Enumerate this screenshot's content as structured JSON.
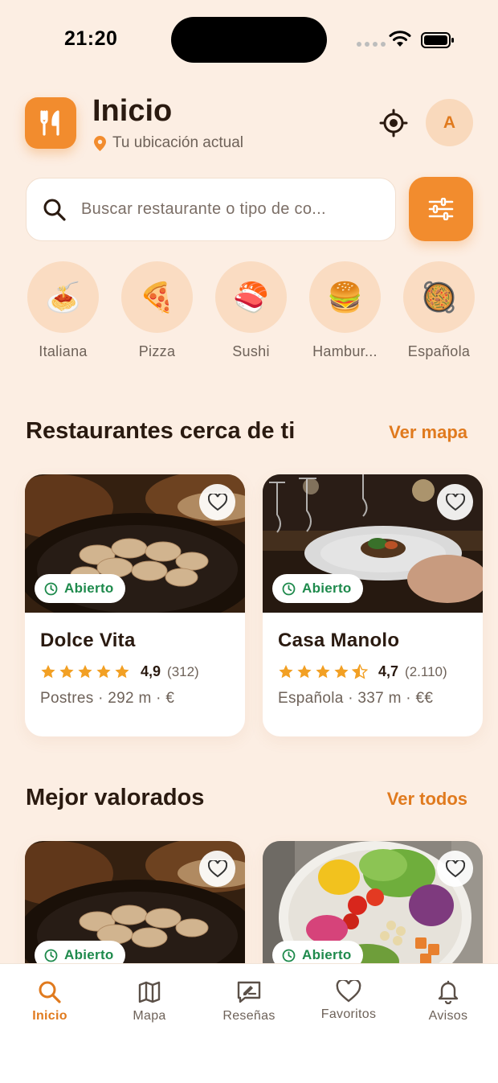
{
  "status": {
    "time": "21:20"
  },
  "header": {
    "title": "Inicio",
    "location": "Tu ubicación actual",
    "avatar_initial": "A"
  },
  "search": {
    "placeholder": "Buscar restaurante o tipo de co..."
  },
  "categories": [
    {
      "label": "Italiana",
      "emoji": "🍝"
    },
    {
      "label": "Pizza",
      "emoji": "🍕"
    },
    {
      "label": "Sushi",
      "emoji": "🍣"
    },
    {
      "label": "Hambur...",
      "emoji": "🍔"
    },
    {
      "label": "Española",
      "emoji": "🥘"
    }
  ],
  "nearby": {
    "title": "Restaurantes cerca de ti",
    "link": "Ver mapa",
    "cards": [
      {
        "name": "Dolce Vita",
        "status": "Abierto",
        "rating": "4,9",
        "rating_stars": 5,
        "reviews": "(312)",
        "meta": "Postres · 292 m · €",
        "photo": "dumplings"
      },
      {
        "name": "Casa Manolo",
        "status": "Abierto",
        "rating": "4,7",
        "rating_stars": 4.5,
        "reviews": "(2.110)",
        "meta": "Española · 337 m · €€",
        "photo": "fine-dining"
      }
    ]
  },
  "top_rated": {
    "title": "Mejor valorados",
    "link": "Ver todos",
    "cards": [
      {
        "status": "Abierto",
        "photo": "dumplings"
      },
      {
        "status": "Abierto",
        "photo": "salad-bowl"
      }
    ]
  },
  "tabs": [
    {
      "label": "Inicio",
      "icon": "search-icon",
      "active": true
    },
    {
      "label": "Mapa",
      "icon": "map-icon",
      "active": false
    },
    {
      "label": "Reseñas",
      "icon": "review-icon",
      "active": false
    },
    {
      "label": "Favoritos",
      "icon": "heart-icon",
      "active": false
    },
    {
      "label": "Avisos",
      "icon": "bell-icon",
      "active": false
    }
  ],
  "colors": {
    "accent": "#F28C2E",
    "background": "#FCEEE3",
    "open_status": "#1E8A4C",
    "star": "#F2A024"
  }
}
